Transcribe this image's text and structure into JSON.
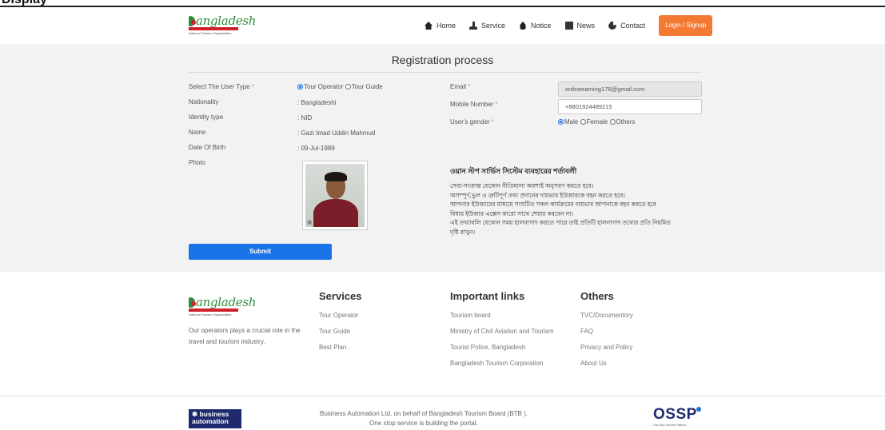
{
  "page": {
    "partial_top_text": "Display"
  },
  "brand": {
    "name": "Bangladesh",
    "band_text": "Tourism Board",
    "sub": "National Tourism Organization",
    "brand_green": "#2e8b3a",
    "brand_red": "#d0212a"
  },
  "nav": {
    "items": [
      {
        "label": "Home",
        "icon": "home-icon"
      },
      {
        "label": "Service",
        "icon": "service-icon"
      },
      {
        "label": "Notice",
        "icon": "notice-icon"
      },
      {
        "label": "News",
        "icon": "news-icon"
      },
      {
        "label": "Contact",
        "icon": "contact-icon"
      }
    ],
    "login_label": "Login / Signup",
    "accent": "#f47a33"
  },
  "form": {
    "title": "Registration process",
    "user_type": {
      "label": "Select The User Type",
      "required": "*",
      "options": [
        "Tour Operator",
        "Tour Guide"
      ],
      "selected": "Tour Operator"
    },
    "nationality": {
      "label": "Nationality",
      "value": ": Bangladeshi"
    },
    "identity": {
      "label": "Identity type",
      "value": ": NID"
    },
    "name": {
      "label": "Name",
      "value": ": Gazi Imad Uddin Mahmud"
    },
    "dob": {
      "label": "Date Of Birth",
      "value": ": 09-Jul-1989"
    },
    "photo": {
      "label": "Photo"
    },
    "email": {
      "label": "Email",
      "required": "*",
      "value": "onlineearning176@gmail.com"
    },
    "mobile": {
      "label": "Mobile Number",
      "required": "*",
      "value": "+8801924489215"
    },
    "gender": {
      "label": "User's gender",
      "required": "*",
      "options": [
        "Male",
        "Female",
        "Others"
      ],
      "selected": "Male"
    },
    "submit_label": "Submit",
    "submit_color": "#1a73e8"
  },
  "terms": {
    "title": "ওয়ান স্টপ সার্ভিস সিস্টেম ব্যবহারের শর্তাবলী",
    "lines": [
      "সেবা-সংক্রান্ত যেকোন নীতিমালা অবশ্যই অনুসরণ করতে হবে।",
      "অসম্পূর্ণ,ভুল ও ত্রুটিপূর্ণ তথ্য প্রদানের দায়ভার ইউজারকে বহন করতে হবে।",
      "আপনার ইউজারের মাধ্যমে সংঘটিত সকল কার্যক্রমের দায়ভার আপনাকে বহন করতে হবে",
      "বিধায় ইউজার এক্সেস কারো সাথে শেয়ার করবেন না।",
      "এই তথ্যাবলি যেকোন সময় হালনাগাদ করতে পারে তাই প্রতিটি হালনাগাদ তথ্যের প্রতি নিয়মিত",
      "দৃষ্টি রাখুন।"
    ]
  },
  "footer": {
    "description": "Our operators plays a crucial role in the travel and tourism industry.",
    "services": {
      "heading": "Services",
      "links": [
        "Tour Operator",
        "Tour Guide",
        "Best Plan"
      ]
    },
    "important": {
      "heading": "Important links",
      "links": [
        "Tourism board",
        "Ministry of Civil Aviation and Tourism",
        "Tourist Police, Bangladesh",
        "Bangladesh Tourism Corporation"
      ]
    },
    "others": {
      "heading": "Others",
      "links": [
        "TVC/Documentory",
        "FAQ",
        "Privacy and Policy",
        "About Us"
      ]
    }
  },
  "bottom": {
    "ba_logo_top": "business",
    "ba_logo_bottom": "automation",
    "copyright_line1": "Business Automation Ltd. on behalf of Bangladesh Tourism Board (BTB ).",
    "copyright_line2": "One stop service is building the portal.",
    "ossp": "OSSP",
    "ossp_sub": "One Stop Service Platform"
  }
}
